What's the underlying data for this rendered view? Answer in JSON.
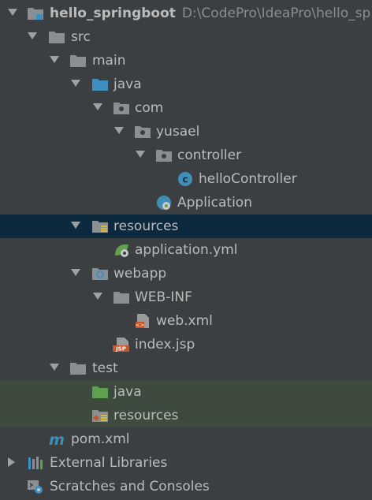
{
  "tree": {
    "project": {
      "name": "hello_springboot",
      "path": "D:\\CodePro\\IdeaPro\\hello_sp"
    },
    "src": "src",
    "main": "main",
    "java": "java",
    "com": "com",
    "yusael": "yusael",
    "controller": "controller",
    "helloController": "helloController",
    "application_class": "Application",
    "resources": "resources",
    "application_yml": "application.yml",
    "webapp": "webapp",
    "web_inf": "WEB-INF",
    "web_xml": "web.xml",
    "index_jsp": "index.jsp",
    "test": "test",
    "test_java": "java",
    "test_resources": "resources",
    "pom_xml": "pom.xml",
    "external_libraries": "External Libraries",
    "scratches": "Scratches and Consoles"
  },
  "icons": {
    "project": "module-folder-icon",
    "folder": "folder-icon",
    "source_root": "source-root-folder-icon",
    "package": "package-icon",
    "class": "class-icon",
    "spring_boot_class": "spring-boot-class-icon",
    "resources_root": "resources-root-icon",
    "spring_yml": "spring-yml-icon",
    "web_folder": "web-folder-icon",
    "xml_file": "xml-file-icon",
    "jsp_file": "jsp-file-icon",
    "test_source_root": "test-source-root-icon",
    "test_resources_root": "test-resources-root-icon",
    "maven": "maven-icon",
    "libraries": "libraries-icon",
    "scratches": "scratches-icon"
  },
  "colors": {
    "background": "#3c3f41",
    "selection": "#0d293e",
    "text": "#bbbbbb",
    "folder": "#8a8f93",
    "source_root": "#3c8fbf",
    "test_root": "#5fa04e",
    "class_badge": "#3d8fb8"
  }
}
